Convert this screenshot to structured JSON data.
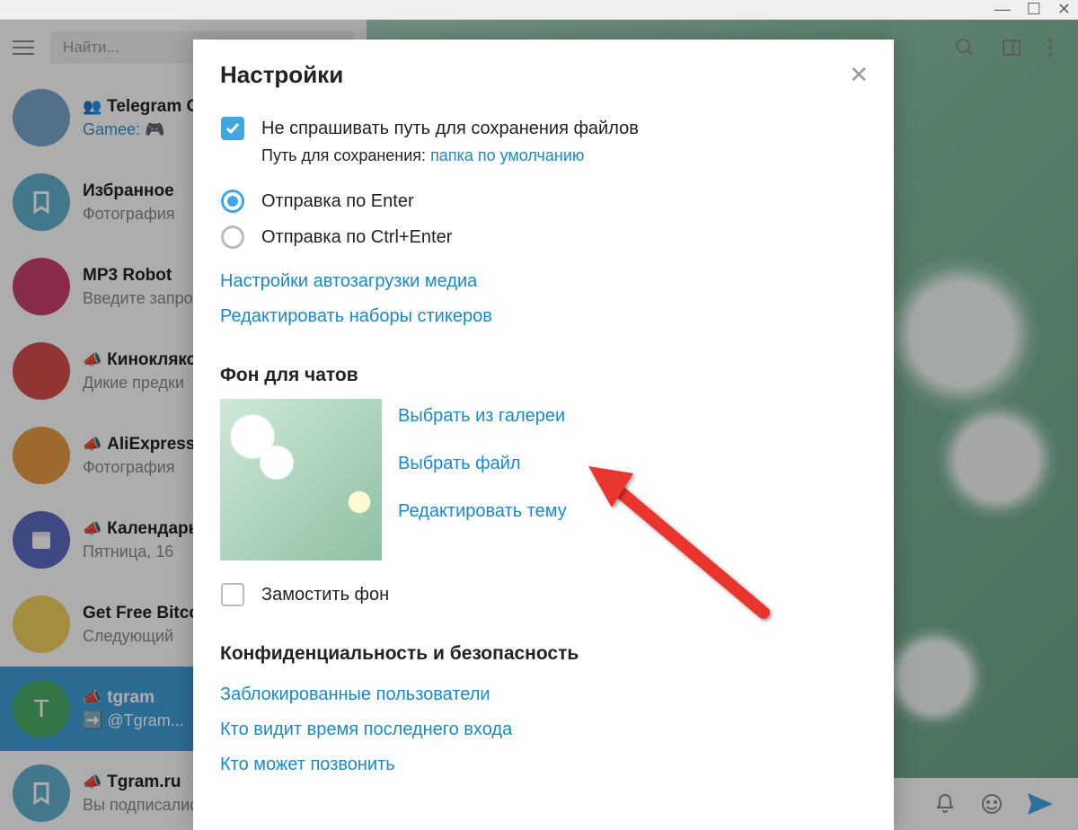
{
  "window": {
    "minimize": "—",
    "maximize": "☐",
    "close": "✕"
  },
  "search": {
    "placeholder": "Найти..."
  },
  "chats": [
    {
      "title": "Telegram Games",
      "icon": "👥",
      "sub": "Gamee: 🎮",
      "sub_link": true,
      "avatar": "#7aa6c9"
    },
    {
      "title": "Избранное",
      "icon": "",
      "sub": "Фотография",
      "avatar": "teal"
    },
    {
      "title": "MP3 Robot",
      "icon": "",
      "sub": "Введите запрос",
      "avatar": "mag"
    },
    {
      "title": "Киноклякса",
      "icon": "📣",
      "sub": "Дикие предки",
      "avatar": "red"
    },
    {
      "title": "AliExpress",
      "icon": "📣",
      "sub": "Фотография",
      "avatar": "orange"
    },
    {
      "title": "Календарь",
      "icon": "📣",
      "sub": "Пятница, 16",
      "avatar": "blue"
    },
    {
      "title": "Get Free Bitcoin",
      "icon": "",
      "sub": "Следующий",
      "avatar": "#f0d060"
    },
    {
      "title": "tgram",
      "icon": "📣",
      "sub": "➡️ @Tgram...",
      "avatar": "green",
      "active": true,
      "letter": "T"
    },
    {
      "title": "Tgram.ru",
      "icon": "📣",
      "sub": "Вы подписались",
      "avatar": "teal"
    }
  ],
  "modal": {
    "title": "Настройки",
    "ask_path": "Не спрашивать путь для сохранения файлов",
    "path_label": "Путь для сохранения:",
    "path_link": "папка по умолчанию",
    "send_enter": "Отправка по Enter",
    "send_ctrl": "Отправка по Ctrl+Enter",
    "autoload": "Настройки автозагрузки медиа",
    "stickers": "Редактировать наборы стикеров",
    "bg_title": "Фон для чатов",
    "bg_gallery": "Выбрать из галереи",
    "bg_file": "Выбрать файл",
    "bg_theme": "Редактировать тему",
    "bg_tile": "Замостить фон",
    "privacy_title": "Конфиденциальность и безопасность",
    "blocked": "Заблокированные пользователи",
    "lastseen": "Кто видит время последнего входа",
    "calls": "Кто может позвонить"
  }
}
